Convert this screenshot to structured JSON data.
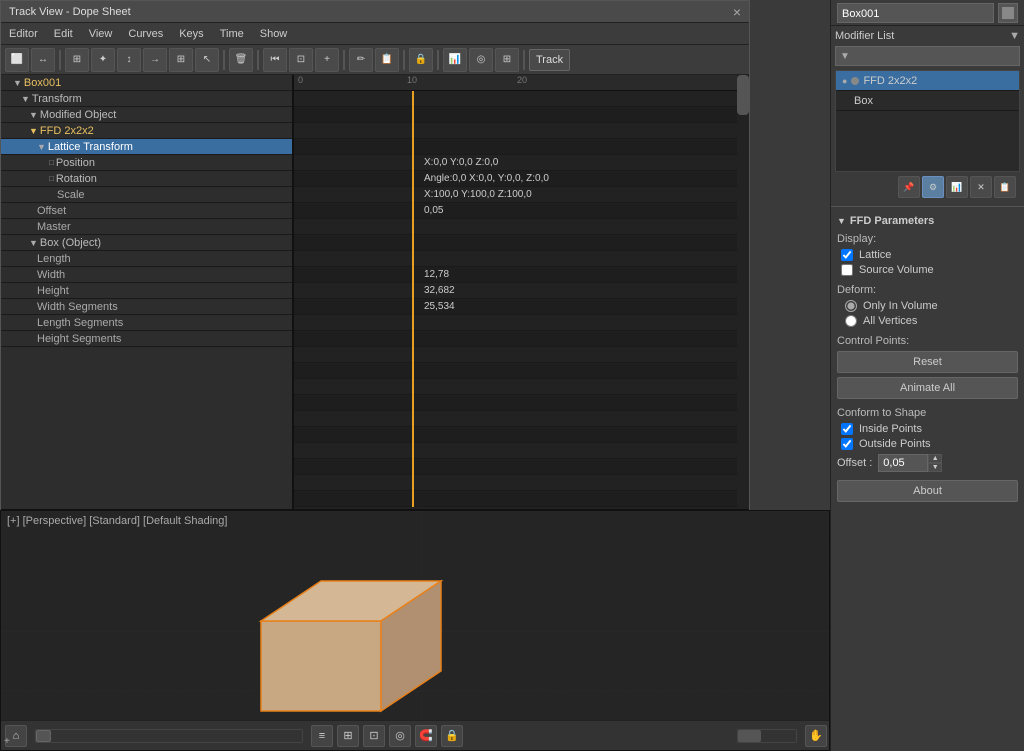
{
  "title_bar": {
    "title": "Track View - Dope Sheet",
    "close_label": "×"
  },
  "menu": {
    "items": [
      "Editor",
      "Edit",
      "View",
      "Curves",
      "Keys",
      "Time",
      "Show"
    ]
  },
  "toolbar": {
    "track_label": "Track"
  },
  "tracks": [
    {
      "label": "Box001",
      "indent": 0,
      "type": "header",
      "expanded": true
    },
    {
      "label": "Transform",
      "indent": 1,
      "type": "normal",
      "expanded": true
    },
    {
      "label": "Modified Object",
      "indent": 2,
      "type": "normal",
      "expanded": true
    },
    {
      "label": "FFD 2x2x2",
      "indent": 3,
      "type": "highlight",
      "expanded": true
    },
    {
      "label": "Lattice Transform",
      "indent": 4,
      "type": "selected",
      "expanded": true
    },
    {
      "label": "Position",
      "indent": 5,
      "type": "normal",
      "expanded": false
    },
    {
      "label": "Rotation",
      "indent": 5,
      "type": "normal",
      "expanded": false
    },
    {
      "label": "Scale",
      "indent": 5,
      "type": "sub",
      "expanded": false
    },
    {
      "label": "Offset",
      "indent": 4,
      "type": "sub"
    },
    {
      "label": "Master",
      "indent": 4,
      "type": "sub"
    },
    {
      "label": "Box (Object)",
      "indent": 3,
      "type": "normal",
      "expanded": true
    },
    {
      "label": "Length",
      "indent": 4,
      "type": "sub"
    },
    {
      "label": "Width",
      "indent": 4,
      "type": "sub"
    },
    {
      "label": "Height",
      "indent": 4,
      "type": "sub"
    },
    {
      "label": "Width Segments",
      "indent": 4,
      "type": "sub"
    },
    {
      "label": "Length Segments",
      "indent": 4,
      "type": "sub"
    },
    {
      "label": "Height Segments",
      "indent": 4,
      "type": "sub"
    }
  ],
  "timeline": {
    "values": {
      "lattice_transform": "X:0,0  Y:0,0  Z:0,0",
      "angle": "Angle:0,0  X:0,0, Y:0,0, Z:0,0",
      "scale_vals": "X:100,0 Y:100,0 Z:100,0",
      "offset": "0,05",
      "length_val": "12,78",
      "width_val": "32,682",
      "height_val": "25,534"
    },
    "ruler_marks": [
      {
        "pos": 0,
        "label": "0"
      },
      {
        "pos": 110,
        "label": "10"
      },
      {
        "pos": 220,
        "label": "20"
      }
    ]
  },
  "right_panel": {
    "object_name": "Box001",
    "modifier_list_label": "Modifier List",
    "modifiers": [
      {
        "name": "FFD 2x2x2",
        "selected": true
      },
      {
        "name": "Box",
        "selected": false
      }
    ],
    "ffd_params": {
      "title": "FFD Parameters",
      "display_label": "Display:",
      "lattice_checked": true,
      "lattice_label": "Lattice",
      "source_volume_checked": false,
      "source_volume_label": "Source Volume",
      "deform_label": "Deform:",
      "only_in_volume_label": "Only In Volume",
      "all_vertices_label": "All Vertices",
      "control_points_label": "Control Points:",
      "reset_label": "Reset",
      "animate_all_label": "Animate All",
      "conform_label": "Conform to Shape",
      "inside_points_checked": true,
      "inside_points_label": "Inside Points",
      "outside_points_checked": true,
      "outside_points_label": "Outside Points",
      "offset_label": "Offset :",
      "offset_value": "0,05",
      "about_label": "About"
    }
  },
  "viewport": {
    "label": "[+] [Perspective] [Standard] [Default Shading]"
  }
}
